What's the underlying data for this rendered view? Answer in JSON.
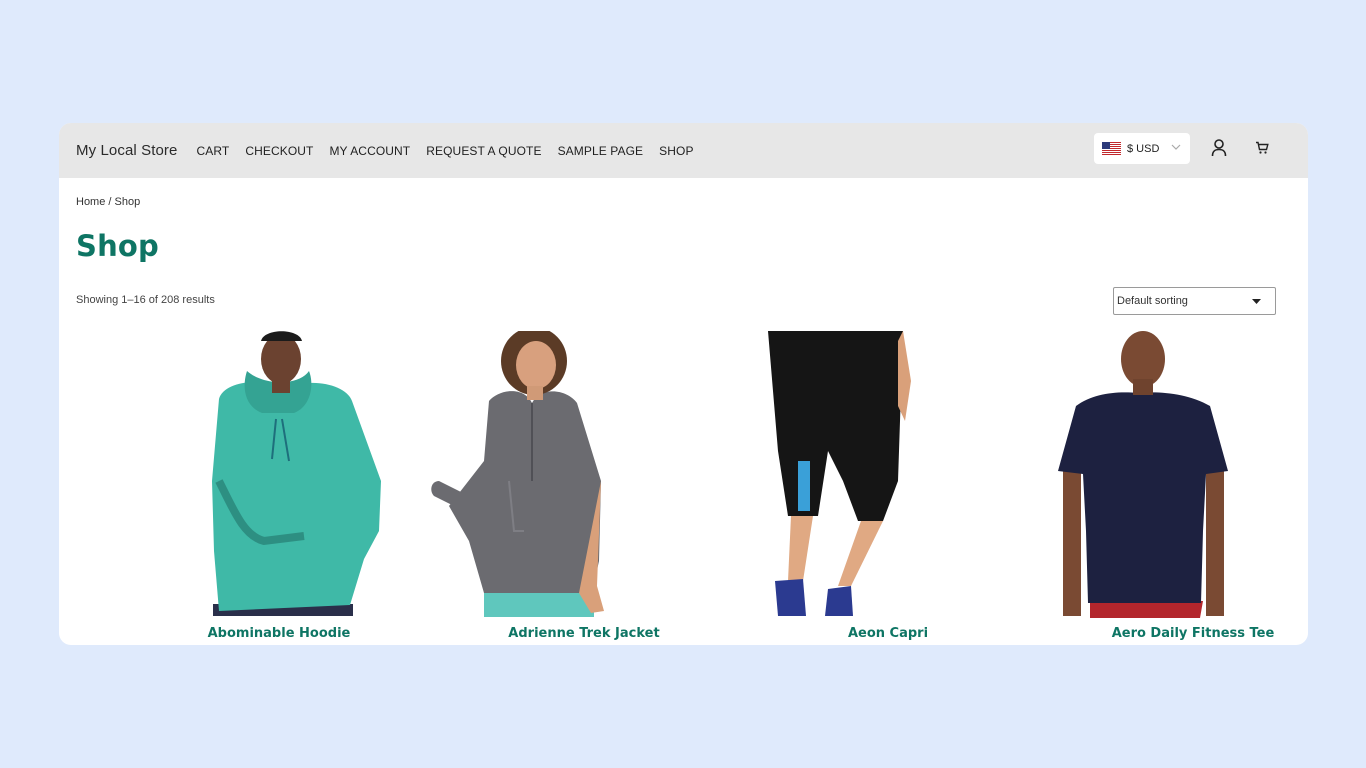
{
  "header": {
    "site_title": "My Local Store",
    "nav": [
      {
        "label": "CART"
      },
      {
        "label": "CHECKOUT"
      },
      {
        "label": "MY ACCOUNT"
      },
      {
        "label": "REQUEST A QUOTE"
      },
      {
        "label": "SAMPLE PAGE"
      },
      {
        "label": "SHOP"
      }
    ],
    "currency": {
      "label": "$ USD",
      "flag": "us-flag-icon"
    },
    "icons": [
      "account-icon",
      "cart-icon"
    ]
  },
  "breadcrumb": "Home / Shop",
  "page_title": "Shop",
  "result_count": "Showing 1–16 of 208 results",
  "sorting": {
    "selected": "Default sorting"
  },
  "products": [
    {
      "name": "Abominable Hoodie",
      "color": "#3fb9a7"
    },
    {
      "name": "Adrienne Trek Jacket",
      "color": "#6b6b70"
    },
    {
      "name": "Aeon Capri",
      "color": "#151515"
    },
    {
      "name": "Aero Daily Fitness Tee",
      "color": "#1d2140"
    }
  ],
  "colors": {
    "accent": "#0e7564",
    "background": "#dfeafc",
    "topbar": "#e7e7e7"
  }
}
